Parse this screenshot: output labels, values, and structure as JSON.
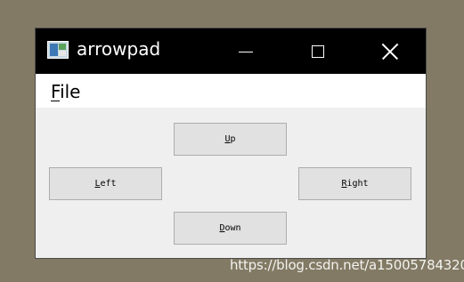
{
  "window": {
    "title": "arrowpad",
    "icon": "app-window-icon",
    "controls": {
      "minimize_icon": "minimize-icon",
      "maximize_icon": "maximize-icon",
      "close_icon": "close-icon"
    }
  },
  "menubar": {
    "items": [
      {
        "label_mnemonic": "F",
        "label_rest": "ile"
      }
    ]
  },
  "buttons": {
    "up": {
      "mnemonic": "U",
      "rest": "p"
    },
    "left": {
      "mnemonic": "L",
      "rest": "eft"
    },
    "right": {
      "mnemonic": "R",
      "rest": "ight"
    },
    "down": {
      "mnemonic": "D",
      "rest": "own"
    }
  },
  "watermark": "https://blog.csdn.net/a15005784320",
  "colors": {
    "desktop": "#827a64",
    "titlebar": "#000000",
    "client": "#efefef",
    "button_face": "#e1e1e1",
    "button_border": "#adadad"
  }
}
